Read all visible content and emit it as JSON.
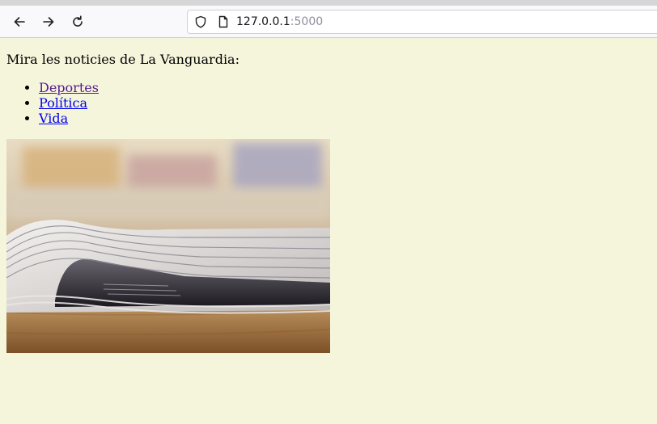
{
  "browser": {
    "url_host": "127.0.0.1",
    "url_port": ":5000",
    "icons": {
      "back": "back-arrow-icon",
      "forward": "forward-arrow-icon",
      "reload": "reload-icon",
      "security": "shield-icon",
      "page": "page-icon"
    }
  },
  "page": {
    "intro": "Mira les noticies de La Vanguardia:",
    "links": [
      {
        "label": "Deportes",
        "visited": true
      },
      {
        "label": "Política",
        "visited": false
      },
      {
        "label": "Vida",
        "visited": false
      }
    ],
    "image_subject": "folded newspapers on a wooden table"
  },
  "colors": {
    "page_background": "#f5f5dc",
    "link": "#0000ee",
    "visited_link": "#551a8b",
    "toolbar": "#f9f9fb"
  }
}
